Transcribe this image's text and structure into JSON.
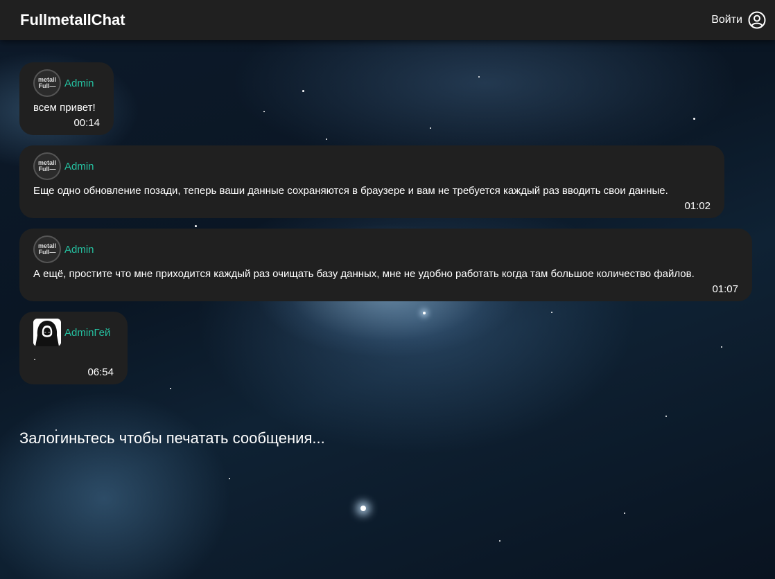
{
  "header": {
    "title": "FullmetallChat",
    "login_label": "Войти"
  },
  "avatar_text": {
    "line1": "metall",
    "line2": "Full—"
  },
  "messages": [
    {
      "author": "Admin",
      "avatar": "metall-logo",
      "text": "всем привет!",
      "time": "00:14"
    },
    {
      "author": "Admin",
      "avatar": "metall-logo",
      "text": "Еще одно обновление позади, теперь ваши данные сохраняются в браузере и вам не требуется каждый раз вводить свои данные.",
      "time": "01:02"
    },
    {
      "author": "Admin",
      "avatar": "metall-logo",
      "text": "А ещё, простите что мне приходится каждый раз очищать базу данных, мне не удобно работать когда там большое количество файлов.",
      "time": "01:07"
    },
    {
      "author": "AdminГей",
      "avatar": "hooded-figure",
      "text": ".",
      "time": "06:54"
    }
  ],
  "login_prompt": "Залогиньтесь чтобы печатать сообщения...",
  "colors": {
    "header_bg": "#202020",
    "bubble_bg": "#202020",
    "author_name": "#25c0a0"
  }
}
